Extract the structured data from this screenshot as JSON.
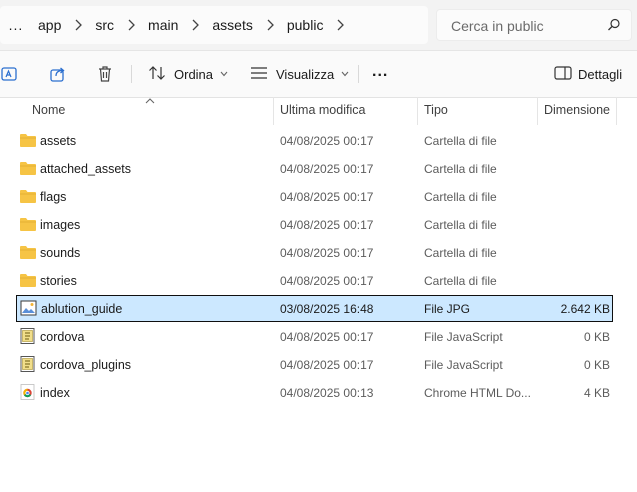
{
  "breadcrumb": {
    "overflow": "...",
    "items": [
      "app",
      "src",
      "main",
      "assets",
      "public"
    ]
  },
  "search": {
    "placeholder": "Cerca in public"
  },
  "toolbar": {
    "sort_label": "Ordina",
    "view_label": "Visualizza",
    "more_label": "...",
    "details_label": "Dettagli"
  },
  "columns": {
    "name": "Nome",
    "modified": "Ultima modifica",
    "type": "Tipo",
    "size": "Dimensione"
  },
  "files": [
    {
      "name": "assets",
      "modified": "04/08/2025 00:17",
      "type": "Cartella di file",
      "size": "",
      "icon": "folder-icon"
    },
    {
      "name": "attached_assets",
      "modified": "04/08/2025 00:17",
      "type": "Cartella di file",
      "size": "",
      "icon": "folder-icon"
    },
    {
      "name": "flags",
      "modified": "04/08/2025 00:17",
      "type": "Cartella di file",
      "size": "",
      "icon": "folder-icon"
    },
    {
      "name": "images",
      "modified": "04/08/2025 00:17",
      "type": "Cartella di file",
      "size": "",
      "icon": "folder-icon"
    },
    {
      "name": "sounds",
      "modified": "04/08/2025 00:17",
      "type": "Cartella di file",
      "size": "",
      "icon": "folder-icon"
    },
    {
      "name": "stories",
      "modified": "04/08/2025 00:17",
      "type": "Cartella di file",
      "size": "",
      "icon": "folder-icon"
    },
    {
      "name": "ablution_guide",
      "modified": "03/08/2025 16:48",
      "type": "File JPG",
      "size": "2.642 KB",
      "icon": "image-file-icon",
      "selected": true
    },
    {
      "name": "cordova",
      "modified": "04/08/2025 00:17",
      "type": "File JavaScript",
      "size": "0 KB",
      "icon": "javascript-file-icon"
    },
    {
      "name": "cordova_plugins",
      "modified": "04/08/2025 00:17",
      "type": "File JavaScript",
      "size": "0 KB",
      "icon": "javascript-file-icon"
    },
    {
      "name": "index",
      "modified": "04/08/2025 00:13",
      "type": "Chrome HTML Do...",
      "size": "4 KB",
      "icon": "chrome-html-icon"
    }
  ],
  "colors": {
    "selection_bg": "#cce8ff",
    "folder": "#f6c445",
    "accent": "#2b6fcf"
  }
}
